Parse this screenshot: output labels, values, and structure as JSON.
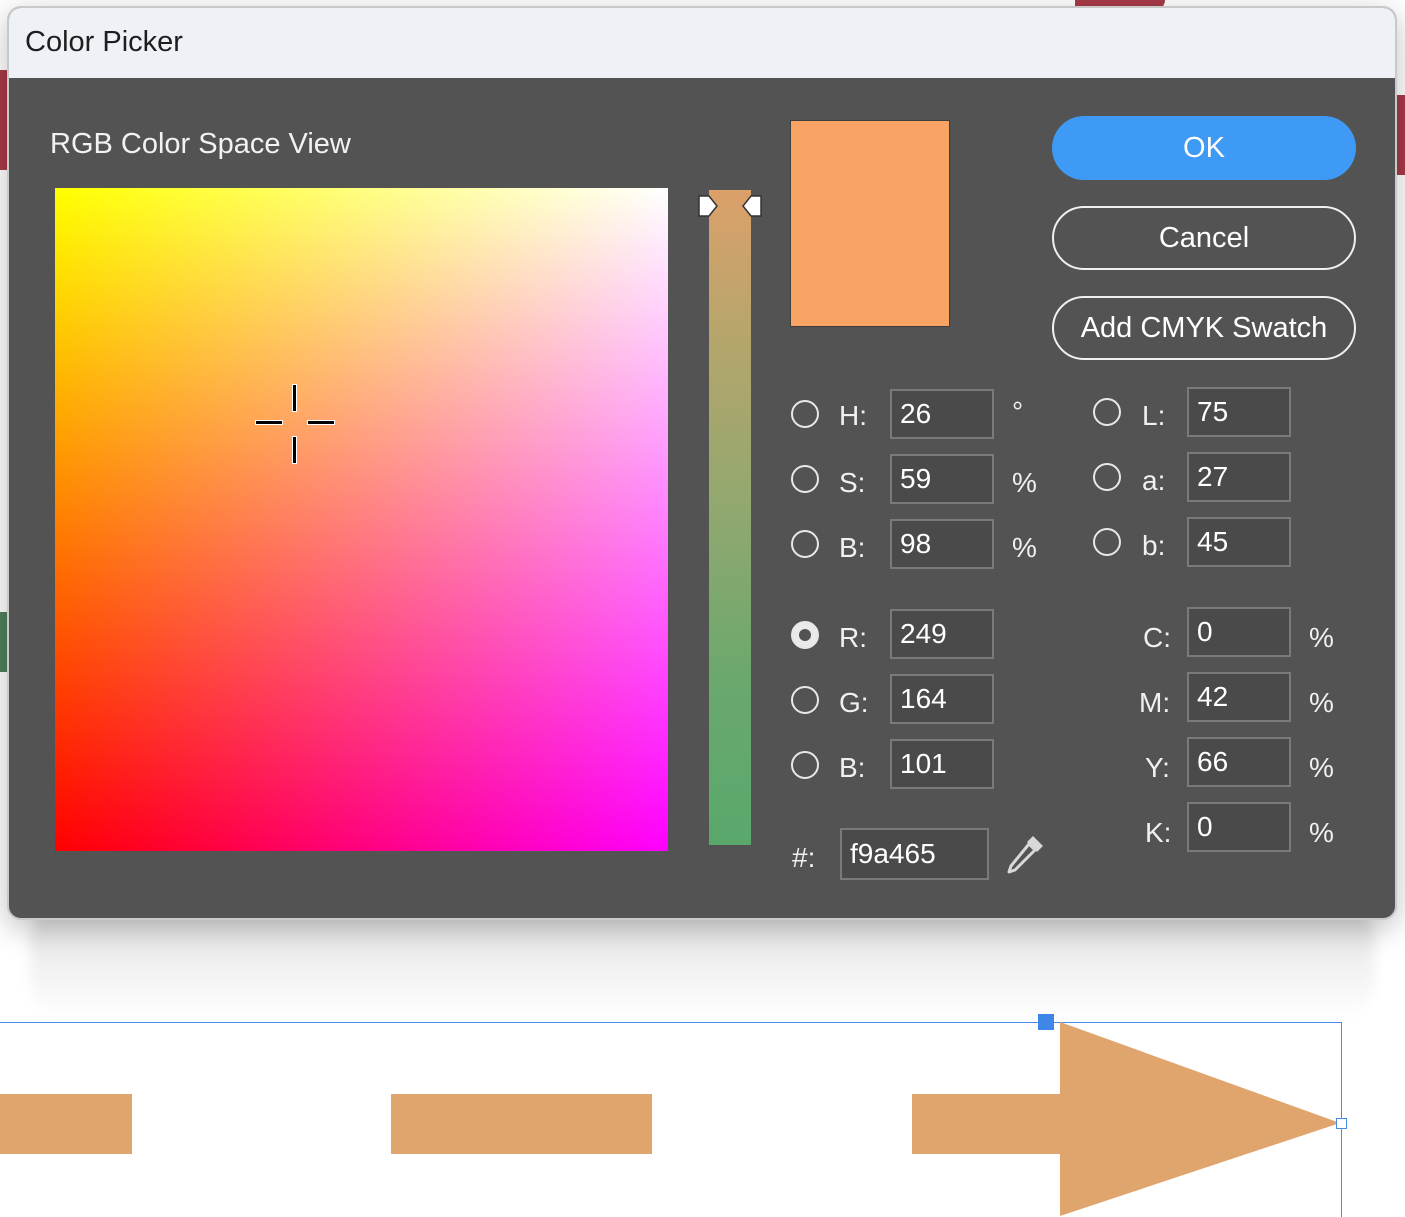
{
  "window": {
    "title": "Color Picker"
  },
  "picker": {
    "section_label": "RGB Color Space View"
  },
  "preview": {
    "color": "#f9a465"
  },
  "buttons": {
    "ok": "OK",
    "cancel": "Cancel",
    "add_swatch": "Add CMYK Swatch"
  },
  "hsb": [
    {
      "label": "H:",
      "value": "26",
      "unit": "°",
      "selected": false
    },
    {
      "label": "S:",
      "value": "59",
      "unit": "%",
      "selected": false
    },
    {
      "label": "B:",
      "value": "98",
      "unit": "%",
      "selected": false
    }
  ],
  "lab": [
    {
      "label": "L:",
      "value": "75",
      "selected": false
    },
    {
      "label": "a:",
      "value": "27",
      "selected": false
    },
    {
      "label": "b:",
      "value": "45",
      "selected": false
    }
  ],
  "rgb": [
    {
      "label": "R:",
      "value": "249",
      "selected": true
    },
    {
      "label": "G:",
      "value": "164",
      "selected": false
    },
    {
      "label": "B:",
      "value": "101",
      "selected": false
    }
  ],
  "cmyk": [
    {
      "label": "C:",
      "value": "0",
      "unit": "%"
    },
    {
      "label": "M:",
      "value": "42",
      "unit": "%"
    },
    {
      "label": "Y:",
      "value": "66",
      "unit": "%"
    },
    {
      "label": "K:",
      "value": "0",
      "unit": "%"
    }
  ],
  "hex": {
    "label": "#:",
    "value": "f9a465"
  },
  "icons": {
    "eyedropper": "eyedropper-icon"
  },
  "colors": {
    "accent": "#3e9af4",
    "dialog_bg": "#535353",
    "artwork_fill": "#e0a46d",
    "selection": "#4a8be8"
  }
}
